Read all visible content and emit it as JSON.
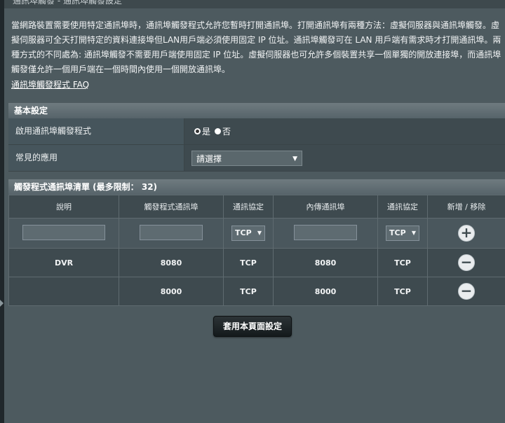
{
  "header": {
    "cut_title": "通訊埠觸發 - 通訊埠觸發設定"
  },
  "description": "當網路裝置需要使用特定通訊埠時，通訊埠觸發程式允許您暫時打開通訊埠。打開通訊埠有兩種方法：虛擬伺服器與通訊埠觸發。虛擬伺服器可全天打開特定的資料連接埠但LAN用戶端必須使用固定 IP 位址。通訊埠觸發可在 LAN 用戶端有需求時才打開通訊埠。兩種方式的不同處為: 通訊埠觸發不需要用戶端使用固定 IP 位址。虛擬伺服器也可允許多個裝置共享一個單獨的開放連接埠，而通訊埠觸發僅允許一個用戶端在一個時間內使用一個開放通訊埠。",
  "faq_link": "通訊埠觸發程式 FAQ",
  "basic": {
    "title": "基本設定",
    "enable_label": "啟用通訊埠觸發程式",
    "yes_label": "是",
    "no_label": "否",
    "enabled": true,
    "common_app_label": "常見的應用",
    "common_app_value": "請選擇"
  },
  "trigger_list": {
    "title": "觸發程式通訊埠清單 (最多限制： 32)",
    "headers": [
      "說明",
      "觸發程式通訊埠",
      "通訊協定",
      "內傳通訊埠",
      "通訊協定",
      "新增 / 移除"
    ],
    "input_row": {
      "protocol1": "TCP",
      "protocol2": "TCP"
    },
    "rows": [
      {
        "description": "DVR",
        "trigger_port": "8080",
        "protocol1": "TCP",
        "incoming_port": "8080",
        "protocol2": "TCP"
      },
      {
        "description": "",
        "trigger_port": "8000",
        "protocol1": "TCP",
        "incoming_port": "8000",
        "protocol2": "TCP"
      }
    ]
  },
  "apply_button": "套用本頁面設定",
  "icons": {
    "add": "plus-circle-icon",
    "remove": "minus-circle-icon",
    "dropdown": "chevron-down-icon"
  }
}
